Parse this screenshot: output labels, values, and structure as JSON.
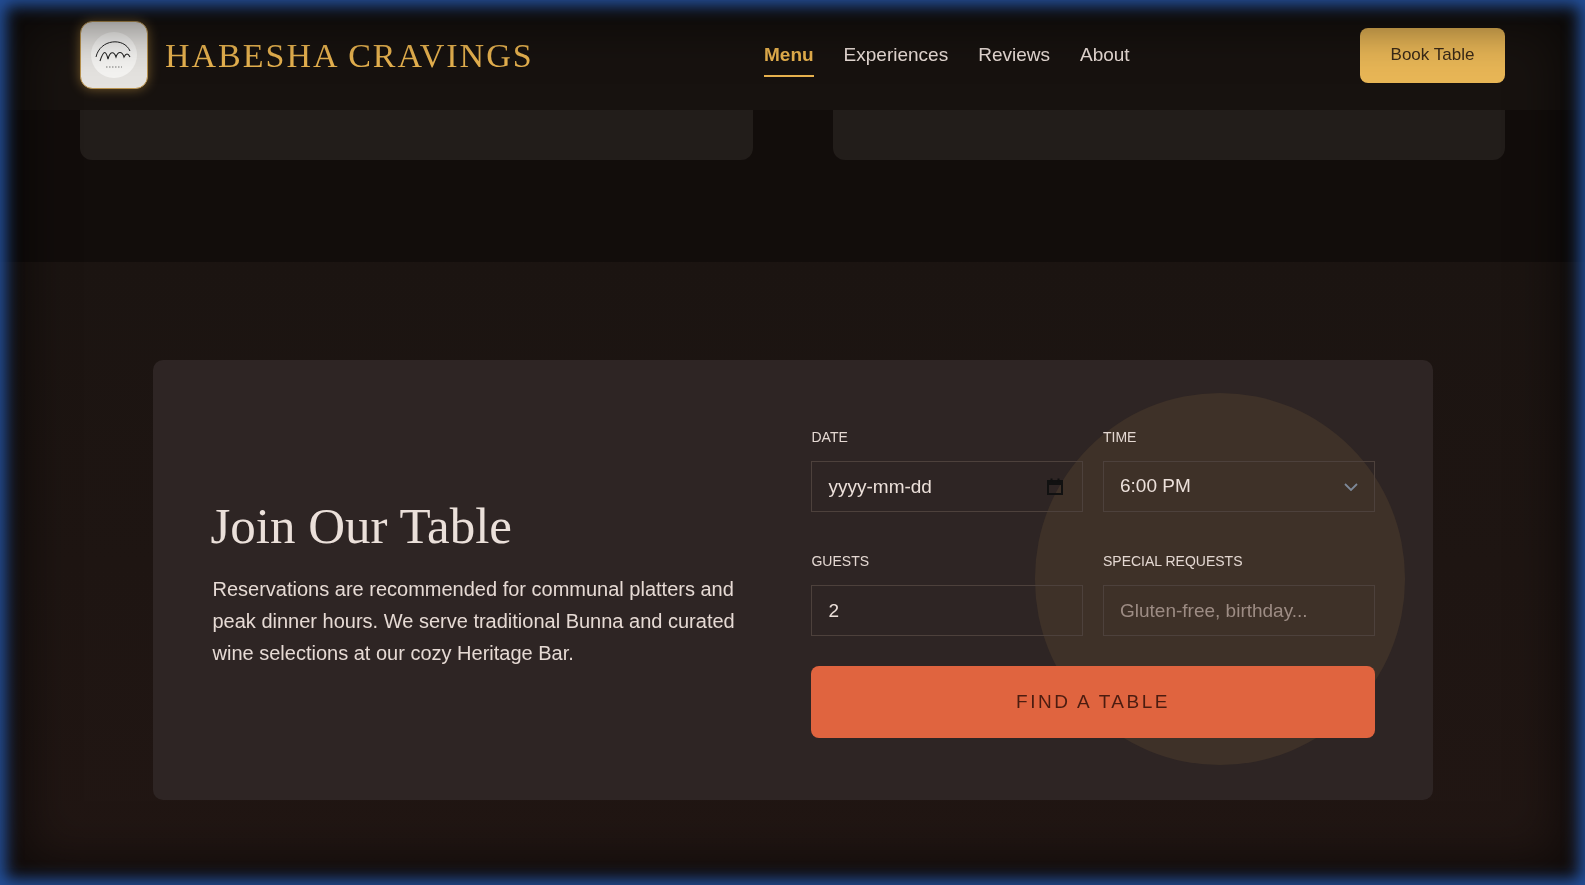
{
  "header": {
    "brand": "HABESHA CRAVINGS",
    "nav": [
      {
        "label": "Menu",
        "selected": true
      },
      {
        "label": "Experiences",
        "selected": false
      },
      {
        "label": "Reviews",
        "selected": false
      },
      {
        "label": "About",
        "selected": false
      }
    ],
    "cta": "Book Table"
  },
  "reservation": {
    "title": "Join Our Table",
    "description": "Reservations are recommended for communal platters and peak dinner hours. We serve traditional Bunna and curated wine selections at our cozy Heritage Bar.",
    "fields": [
      {
        "kind": "date",
        "label": "DATE",
        "placeholder": "yyyy-mm-dd"
      },
      {
        "kind": "select",
        "label": "TIME",
        "value": "6:00 PM"
      },
      {
        "kind": "number",
        "label": "GUESTS",
        "value": "2"
      },
      {
        "kind": "text",
        "label": "SPECIAL REQUESTS",
        "placeholder": "Gluten-free, birthday..."
      }
    ],
    "submit": "FIND A TABLE"
  }
}
